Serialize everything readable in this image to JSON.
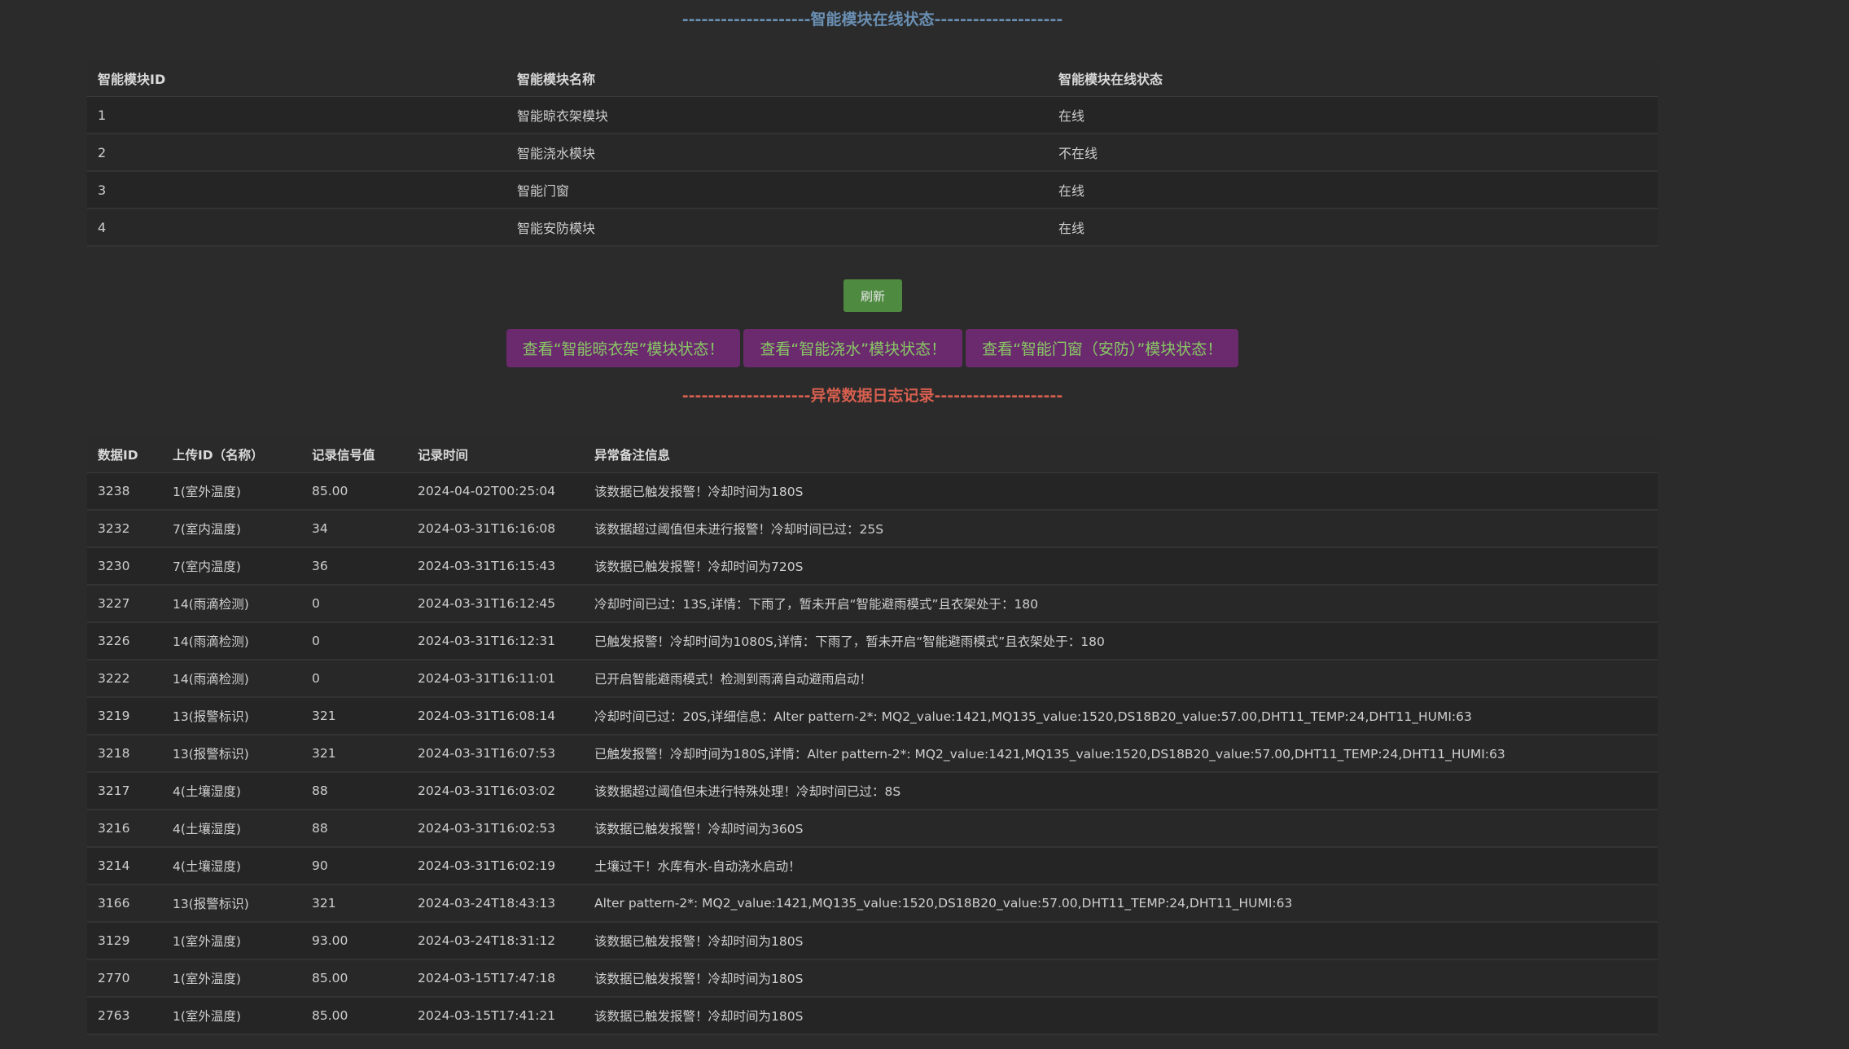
{
  "online_section": {
    "title": "--------------------智能模块在线状态--------------------",
    "headers": [
      "智能模块ID",
      "智能模块名称",
      "智能模块在线状态"
    ],
    "rows": [
      {
        "id": "1",
        "name": "智能晾衣架模块",
        "status": "在线",
        "online": true
      },
      {
        "id": "2",
        "name": "智能浇水模块",
        "status": "不在线",
        "online": false
      },
      {
        "id": "3",
        "name": "智能门窗",
        "status": "在线",
        "online": true
      },
      {
        "id": "4",
        "name": "智能安防模块",
        "status": "在线",
        "online": true
      }
    ],
    "status_colors": {
      "online": "#6abf55",
      "offline": "#e0533f"
    }
  },
  "actions": {
    "refresh_label": "刷新",
    "module_buttons": [
      "查看“智能晾衣架”模块状态！",
      "查看“智能浇水”模块状态！",
      "查看“智能门窗（安防）”模块状态！"
    ]
  },
  "log_section": {
    "title": "--------------------异常数据日志记录--------------------",
    "headers": [
      "数据ID",
      "上传ID（名称）",
      "记录信号值",
      "记录时间",
      "异常备注信息"
    ],
    "rows": [
      [
        "3238",
        "1(室外温度)",
        "85.00",
        "2024-04-02T00:25:04",
        "该数据已触发报警！冷却时间为180S"
      ],
      [
        "3232",
        "7(室内温度)",
        "34",
        "2024-03-31T16:16:08",
        "该数据超过阈值但未进行报警！冷却时间已过：25S"
      ],
      [
        "3230",
        "7(室内温度)",
        "36",
        "2024-03-31T16:15:43",
        "该数据已触发报警！冷却时间为720S"
      ],
      [
        "3227",
        "14(雨滴检测)",
        "0",
        "2024-03-31T16:12:45",
        "冷却时间已过：13S,详情：下雨了，暂未开启“智能避雨模式”且衣架处于：180"
      ],
      [
        "3226",
        "14(雨滴检测)",
        "0",
        "2024-03-31T16:12:31",
        "已触发报警！冷却时间为1080S,详情：下雨了，暂未开启“智能避雨模式”且衣架处于：180"
      ],
      [
        "3222",
        "14(雨滴检测)",
        "0",
        "2024-03-31T16:11:01",
        "已开启智能避雨模式！检测到雨滴自动避雨启动！"
      ],
      [
        "3219",
        "13(报警标识)",
        "321",
        "2024-03-31T16:08:14",
        "冷却时间已过：20S,详细信息：Alter pattern-2*: MQ2_value:1421,MQ135_value:1520,DS18B20_value:57.00,DHT11_TEMP:24,DHT11_HUMI:63"
      ],
      [
        "3218",
        "13(报警标识)",
        "321",
        "2024-03-31T16:07:53",
        "已触发报警！冷却时间为180S,详情：Alter pattern-2*: MQ2_value:1421,MQ135_value:1520,DS18B20_value:57.00,DHT11_TEMP:24,DHT11_HUMI:63"
      ],
      [
        "3217",
        "4(土壤湿度)",
        "88",
        "2024-03-31T16:03:02",
        "该数据超过阈值但未进行特殊处理！冷却时间已过：8S"
      ],
      [
        "3216",
        "4(土壤湿度)",
        "88",
        "2024-03-31T16:02:53",
        "该数据已触发报警！冷却时间为360S"
      ],
      [
        "3214",
        "4(土壤湿度)",
        "90",
        "2024-03-31T16:02:19",
        "土壤过干！水库有水-自动浇水启动！"
      ],
      [
        "3166",
        "13(报警标识)",
        "321",
        "2024-03-24T18:43:13",
        "Alter pattern-2*: MQ2_value:1421,MQ135_value:1520,DS18B20_value:57.00,DHT11_TEMP:24,DHT11_HUMI:63"
      ],
      [
        "3129",
        "1(室外温度)",
        "93.00",
        "2024-03-24T18:31:12",
        "该数据已触发报警！冷却时间为180S"
      ],
      [
        "2770",
        "1(室外温度)",
        "85.00",
        "2024-03-15T17:47:18",
        "该数据已触发报警！冷却时间为180S"
      ],
      [
        "2763",
        "1(室外温度)",
        "85.00",
        "2024-03-15T17:41:21",
        "该数据已触发报警！冷却时间为180S"
      ]
    ]
  },
  "colors": {
    "background": "#2b2b2b",
    "title_blue": "#6a8fb3",
    "title_red": "#d75f4f",
    "refresh_button": "#4e8a3f",
    "module_button_bg": "#6b2a6e",
    "module_button_text": "#88c765"
  }
}
